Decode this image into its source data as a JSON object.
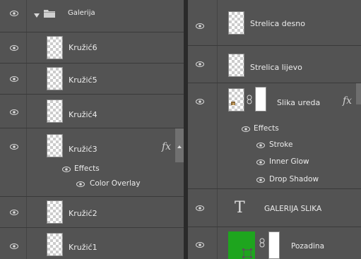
{
  "left": {
    "group": {
      "label": "Galerija"
    },
    "layers": [
      {
        "label": "Kružić6"
      },
      {
        "label": "Kružić5"
      },
      {
        "label": "Kružić4"
      },
      {
        "label": "Kružić3",
        "fx": "fx",
        "effects_label": "Effects",
        "effects": [
          "Color Overlay"
        ]
      },
      {
        "label": "Kružić2"
      },
      {
        "label": "Kružić1"
      }
    ]
  },
  "right": {
    "layers": [
      {
        "label": "Strelica desno"
      },
      {
        "label": "Strelica lijevo"
      },
      {
        "label": "Slika ureda",
        "fx": "fx",
        "effects_label": "Effects",
        "effects": [
          "Stroke",
          "Inner Glow",
          "Drop Shadow"
        ]
      },
      {
        "label": "GALERIJA SLIKA",
        "type_glyph": "T"
      },
      {
        "label": "Pozadina",
        "color": "#1ea51e"
      }
    ]
  },
  "colors": {
    "panel": "#535353",
    "divider": "#3a3a3a",
    "text": "#ececec",
    "green": "#1ea51e"
  }
}
